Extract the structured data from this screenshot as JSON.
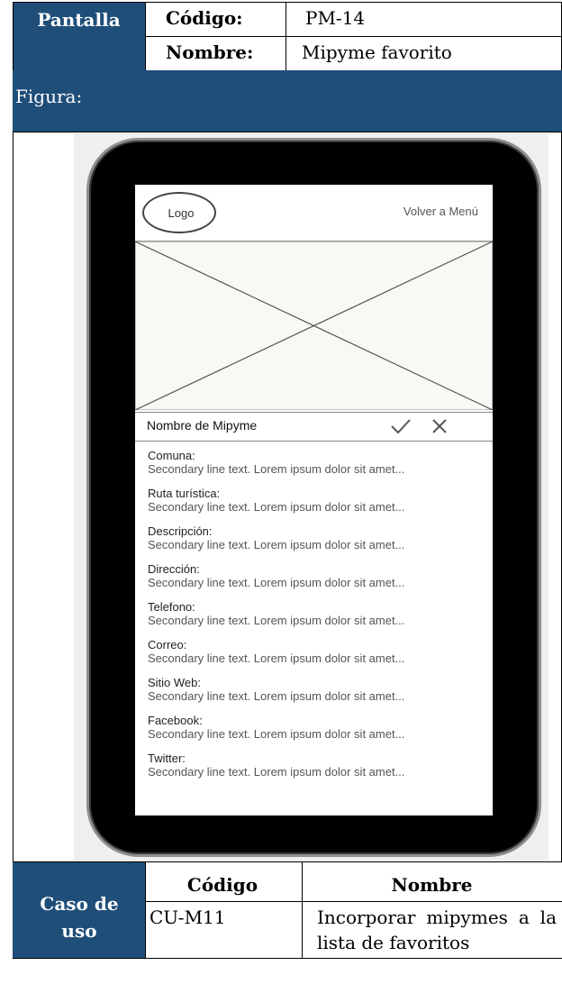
{
  "header": {
    "pantalla_label": "Pantalla",
    "codigo_label": "Código:",
    "codigo_value": "PM-14",
    "nombre_label": "Nombre:",
    "nombre_value": "Mipyme favorito"
  },
  "figura_label": "Figura:",
  "mockup": {
    "logo": "Logo",
    "back_link": "Volver a Menú",
    "title": "Nombre de Mipyme",
    "accept_icon": "check-icon",
    "cancel_icon": "close-icon",
    "rows": [
      {
        "label": "Comuna:",
        "text": "Secondary line text. Lorem ipsum dolor sit amet..."
      },
      {
        "label": "Ruta turística:",
        "text": "Secondary line text. Lorem ipsum dolor sit amet..."
      },
      {
        "label": "Descripción:",
        "text": "Secondary line text. Lorem ipsum dolor sit amet..."
      },
      {
        "label": "Dirección:",
        "text": "Secondary line text. Lorem ipsum dolor sit amet..."
      },
      {
        "label": "Telefono:",
        "text": "Secondary line text. Lorem ipsum dolor sit amet..."
      },
      {
        "label": "Correo:",
        "text": "Secondary line text. Lorem ipsum dolor sit amet..."
      },
      {
        "label": "Sitio Web:",
        "text": "Secondary line text. Lorem ipsum dolor sit amet..."
      },
      {
        "label": "Facebook:",
        "text": "Secondary line text. Lorem ipsum dolor sit amet..."
      },
      {
        "label": "Twitter:",
        "text": "Secondary line text. Lorem ipsum dolor sit amet..."
      }
    ]
  },
  "caso_de_uso": {
    "label": "Caso de uso",
    "codigo_header": "Código",
    "nombre_header": "Nombre",
    "codigo_value": "CU-M11",
    "nombre_value": "Incorporar mipymes a la lista de favoritos"
  },
  "colors": {
    "header_bg": "#1f4e79",
    "phone_body": "#000000",
    "screen_bg": "#ffffff"
  }
}
